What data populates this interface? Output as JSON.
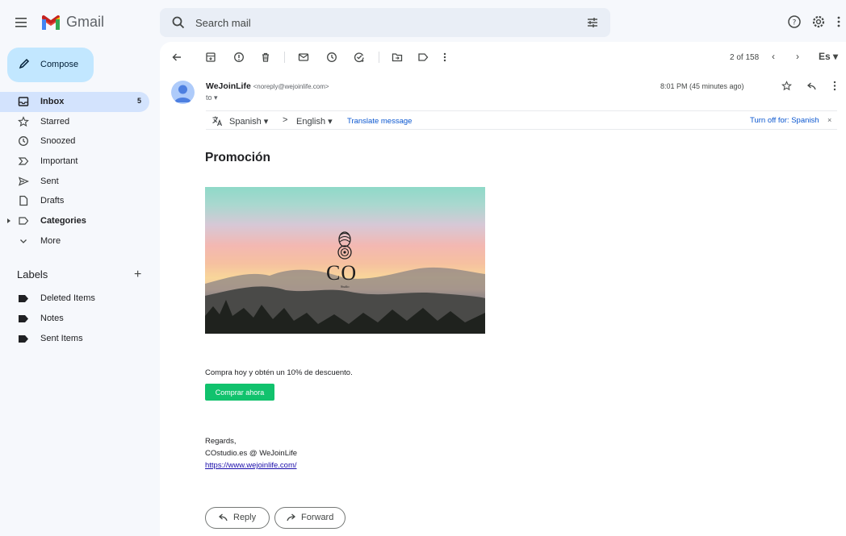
{
  "app": {
    "name": "Gmail"
  },
  "search": {
    "placeholder": "Search mail"
  },
  "sidebar": {
    "compose_label": "Compose",
    "items": [
      {
        "label": "Inbox",
        "count": "5",
        "icon": "inbox-icon"
      },
      {
        "label": "Starred",
        "icon": "star-icon"
      },
      {
        "label": "Snoozed",
        "icon": "clock-icon"
      },
      {
        "label": "Important",
        "icon": "important-icon"
      },
      {
        "label": "Sent",
        "icon": "send-icon"
      },
      {
        "label": "Drafts",
        "icon": "draft-icon"
      },
      {
        "label": "Categories",
        "icon": "label-icon"
      },
      {
        "label": "More",
        "icon": "chevron-down-icon"
      }
    ],
    "labels_title": "Labels",
    "labels": [
      "Deleted Items",
      "Notes",
      "Sent Items"
    ]
  },
  "toolbar": {
    "pager": "2 of 158",
    "prev": "‹",
    "next": "›",
    "lang": "Es ▾"
  },
  "email": {
    "sender_name": "WeJoinLife",
    "sender_email": "<noreply@wejoinlife.com>",
    "to": "to ▾",
    "time": "8:01 PM (45 minutes ago)",
    "translate": {
      "from": "Spanish ▾",
      "arrow": ">",
      "to": "English ▾",
      "link": "Translate message",
      "off": "Turn off for: Spanish",
      "close": "×"
    },
    "subject": "Promoción",
    "hero": {
      "logo_text": "CO",
      "logo_sub": "Studio"
    },
    "body": "Compra hoy y obtén un 10% de descuento.",
    "cta": "Comprar ahora",
    "signature": [
      "Regards,",
      "COstudio.es @ WeJoinLife",
      "https://www.wejoinlife.com/"
    ],
    "reply_label": "Reply",
    "forward_label": "Forward"
  },
  "colors": {
    "accent": "#0b57d0",
    "compose_bg": "#c2e7ff",
    "active_nav": "#d3e3fd",
    "cta": "#11c26d"
  }
}
